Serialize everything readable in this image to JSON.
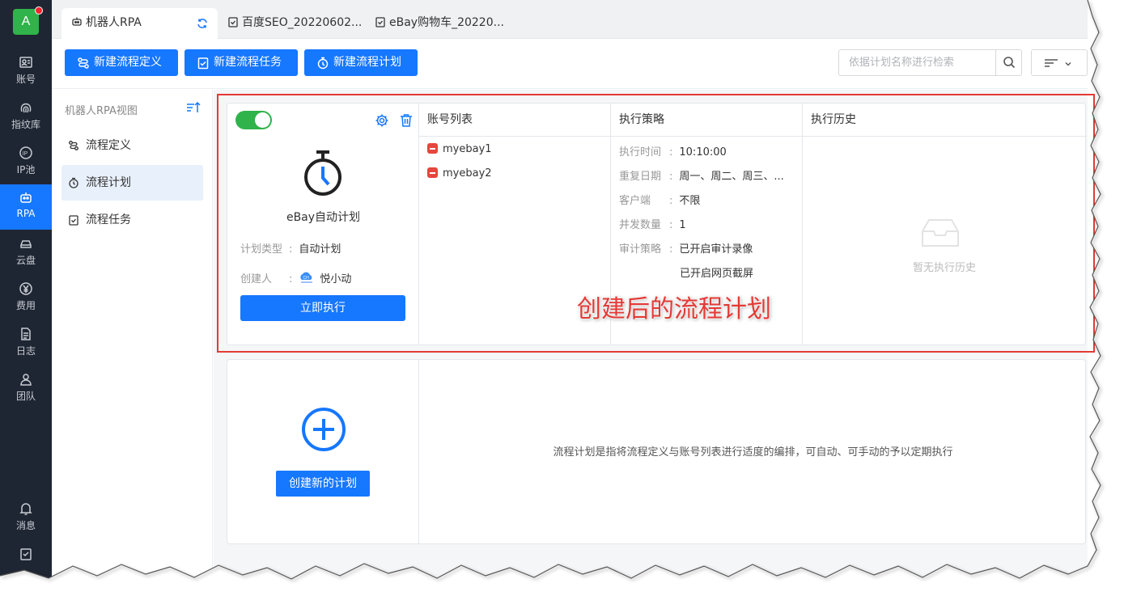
{
  "leftnav": {
    "avatar": "A",
    "items": [
      {
        "label": "账号",
        "icon": "account-icon"
      },
      {
        "label": "指纹库",
        "icon": "fingerprint-icon"
      },
      {
        "label": "IP池",
        "icon": "ip-icon"
      },
      {
        "label": "RPA",
        "icon": "robot-icon",
        "active": true
      },
      {
        "label": "云盘",
        "icon": "cloud-drive-icon"
      },
      {
        "label": "费用",
        "icon": "yuan-icon"
      },
      {
        "label": "日志",
        "icon": "log-icon"
      },
      {
        "label": "团队",
        "icon": "team-icon"
      },
      {
        "label": "消息",
        "icon": "bell-icon"
      }
    ]
  },
  "tabs": [
    {
      "label": "机器人RPA",
      "active": true
    },
    {
      "label": "百度SEO_20220602..."
    },
    {
      "label": "eBay购物车_20220..."
    }
  ],
  "toolbar": {
    "new_definition": "新建流程定义",
    "new_task": "新建流程任务",
    "new_plan": "新建流程计划",
    "search_placeholder": "依据计划名称进行检索"
  },
  "sidebar": {
    "title": "机器人RPA视图",
    "items": [
      {
        "label": "流程定义"
      },
      {
        "label": "流程计划",
        "active": true
      },
      {
        "label": "流程任务"
      }
    ]
  },
  "plan": {
    "enabled": true,
    "name": "eBay自动计划",
    "type_label": "计划类型",
    "type_value": "自动计划",
    "creator_label": "创建人",
    "creator_value": "悦小动",
    "run_button": "立即执行",
    "accounts_header": "账号列表",
    "accounts": [
      "myebay1",
      "myebay2"
    ],
    "strategy_header": "执行策略",
    "strategy": [
      {
        "k": "执行时间",
        "v": "10:10:00"
      },
      {
        "k": "重复日期",
        "v": "周一、周二、周三、..."
      },
      {
        "k": "客户端",
        "v": "不限"
      },
      {
        "k": "并发数量",
        "v": "1"
      },
      {
        "k": "审计策略",
        "v": "已开启审计录像"
      },
      {
        "k": "",
        "v": "已开启网页截屏"
      }
    ],
    "history_header": "执行历史",
    "history_empty": "暂无执行历史"
  },
  "new_plan": {
    "button": "创建新的计划",
    "description": "流程计划是指将流程定义与账号列表进行适度的编排，可自动、可手动的予以定期执行"
  },
  "annotation": "创建后的流程计划",
  "colors": {
    "primary": "#1677ff",
    "nav_bg": "#1f2633",
    "toggle_on": "#2fb34a",
    "annotation_red": "#e53935"
  }
}
